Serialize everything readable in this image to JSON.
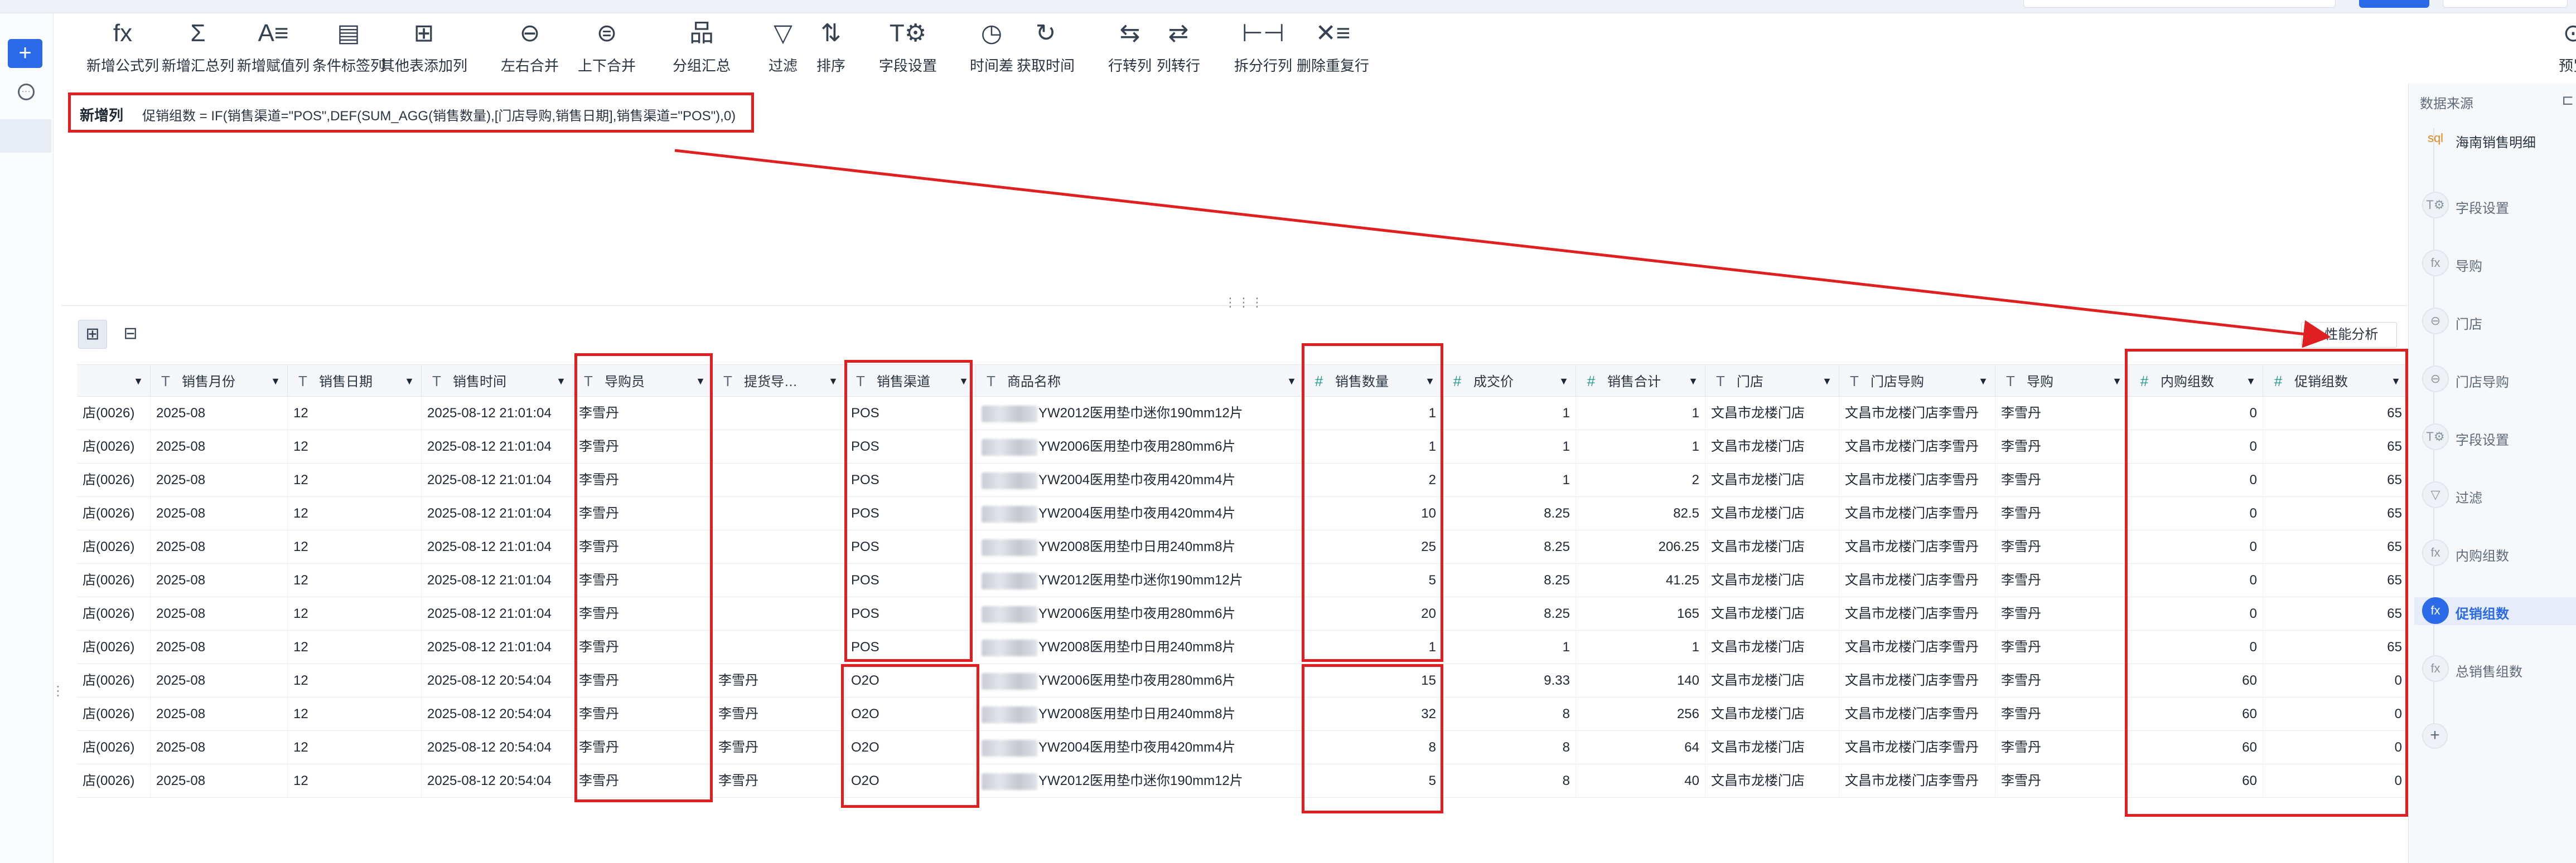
{
  "toolbar": [
    {
      "icon": "fx",
      "label": "新增公式列"
    },
    {
      "icon": "Σ",
      "label": "新增汇总列"
    },
    {
      "icon": "A≡",
      "label": "新增赋值列"
    },
    {
      "icon": "▤",
      "label": "条件标签列"
    },
    {
      "icon": "⊞",
      "label": "其他表添加列"
    },
    {
      "icon": "⊖",
      "label": "左右合并"
    },
    {
      "icon": "⊜",
      "label": "上下合并"
    },
    {
      "icon": "品",
      "label": "分组汇总"
    },
    {
      "icon": "▽",
      "label": "过滤"
    },
    {
      "icon": "⇅",
      "label": "排序"
    },
    {
      "icon": "T⚙",
      "label": "字段设置"
    },
    {
      "icon": "◷",
      "label": "时间差"
    },
    {
      "icon": "↻",
      "label": "获取时间"
    },
    {
      "icon": "⇆",
      "label": "行转列"
    },
    {
      "icon": "⇄",
      "label": "列转行"
    },
    {
      "icon": "⊢⊣",
      "label": "拆分行列"
    },
    {
      "icon": "✕≡",
      "label": "删除重复行"
    },
    {
      "icon": "⊙",
      "label": "预览"
    }
  ],
  "formula": {
    "tag": "新增列",
    "expression": "促销组数 = IF(销售渠道=\"POS\",DEF(SUM_AGG(销售数量),[门店导购,销售日期],销售渠道=\"POS\"),0)"
  },
  "perf_button": "性能分析",
  "columns": [
    {
      "name": "",
      "type": "T"
    },
    {
      "name": "销售月份",
      "type": "T"
    },
    {
      "name": "销售日期",
      "type": "T"
    },
    {
      "name": "销售时间",
      "type": "T"
    },
    {
      "name": "导购员",
      "type": "T"
    },
    {
      "name": "提货导…",
      "type": "T"
    },
    {
      "name": "销售渠道",
      "type": "T"
    },
    {
      "name": "商品名称",
      "type": "T"
    },
    {
      "name": "销售数量",
      "type": "#"
    },
    {
      "name": "成交价",
      "type": "#"
    },
    {
      "name": "销售合计",
      "type": "#"
    },
    {
      "name": "门店",
      "type": "T"
    },
    {
      "name": "门店导购",
      "type": "T"
    },
    {
      "name": "导购",
      "type": "T"
    },
    {
      "name": "内购组数",
      "type": "#"
    },
    {
      "name": "促销组数",
      "type": "#"
    }
  ],
  "rows": [
    [
      "店(0026)",
      "2025-08",
      "12",
      "2025-08-12 21:01:04",
      "李雪丹",
      "",
      "POS",
      "YW2012医用垫巾迷你190mm12片",
      "1",
      "1",
      "1",
      "文昌市龙楼门店",
      "文昌市龙楼门店李雪丹",
      "李雪丹",
      "0",
      "65"
    ],
    [
      "店(0026)",
      "2025-08",
      "12",
      "2025-08-12 21:01:04",
      "李雪丹",
      "",
      "POS",
      "YW2006医用垫巾夜用280mm6片",
      "1",
      "1",
      "1",
      "文昌市龙楼门店",
      "文昌市龙楼门店李雪丹",
      "李雪丹",
      "0",
      "65"
    ],
    [
      "店(0026)",
      "2025-08",
      "12",
      "2025-08-12 21:01:04",
      "李雪丹",
      "",
      "POS",
      "YW2004医用垫巾夜用420mm4片",
      "2",
      "1",
      "2",
      "文昌市龙楼门店",
      "文昌市龙楼门店李雪丹",
      "李雪丹",
      "0",
      "65"
    ],
    [
      "店(0026)",
      "2025-08",
      "12",
      "2025-08-12 21:01:04",
      "李雪丹",
      "",
      "POS",
      "YW2004医用垫巾夜用420mm4片",
      "10",
      "8.25",
      "82.5",
      "文昌市龙楼门店",
      "文昌市龙楼门店李雪丹",
      "李雪丹",
      "0",
      "65"
    ],
    [
      "店(0026)",
      "2025-08",
      "12",
      "2025-08-12 21:01:04",
      "李雪丹",
      "",
      "POS",
      "YW2008医用垫巾日用240mm8片",
      "25",
      "8.25",
      "206.25",
      "文昌市龙楼门店",
      "文昌市龙楼门店李雪丹",
      "李雪丹",
      "0",
      "65"
    ],
    [
      "店(0026)",
      "2025-08",
      "12",
      "2025-08-12 21:01:04",
      "李雪丹",
      "",
      "POS",
      "YW2012医用垫巾迷你190mm12片",
      "5",
      "8.25",
      "41.25",
      "文昌市龙楼门店",
      "文昌市龙楼门店李雪丹",
      "李雪丹",
      "0",
      "65"
    ],
    [
      "店(0026)",
      "2025-08",
      "12",
      "2025-08-12 21:01:04",
      "李雪丹",
      "",
      "POS",
      "YW2006医用垫巾夜用280mm6片",
      "20",
      "8.25",
      "165",
      "文昌市龙楼门店",
      "文昌市龙楼门店李雪丹",
      "李雪丹",
      "0",
      "65"
    ],
    [
      "店(0026)",
      "2025-08",
      "12",
      "2025-08-12 21:01:04",
      "李雪丹",
      "",
      "POS",
      "YW2008医用垫巾日用240mm8片",
      "1",
      "1",
      "1",
      "文昌市龙楼门店",
      "文昌市龙楼门店李雪丹",
      "李雪丹",
      "0",
      "65"
    ],
    [
      "店(0026)",
      "2025-08",
      "12",
      "2025-08-12 20:54:04",
      "李雪丹",
      "李雪丹",
      "O2O",
      "YW2006医用垫巾夜用280mm6片",
      "15",
      "9.33",
      "140",
      "文昌市龙楼门店",
      "文昌市龙楼门店李雪丹",
      "李雪丹",
      "60",
      "0"
    ],
    [
      "店(0026)",
      "2025-08",
      "12",
      "2025-08-12 20:54:04",
      "李雪丹",
      "李雪丹",
      "O2O",
      "YW2008医用垫巾日用240mm8片",
      "32",
      "8",
      "256",
      "文昌市龙楼门店",
      "文昌市龙楼门店李雪丹",
      "李雪丹",
      "60",
      "0"
    ],
    [
      "店(0026)",
      "2025-08",
      "12",
      "2025-08-12 20:54:04",
      "李雪丹",
      "李雪丹",
      "O2O",
      "YW2004医用垫巾夜用420mm4片",
      "8",
      "8",
      "64",
      "文昌市龙楼门店",
      "文昌市龙楼门店李雪丹",
      "李雪丹",
      "60",
      "0"
    ],
    [
      "店(0026)",
      "2025-08",
      "12",
      "2025-08-12 20:54:04",
      "李雪丹",
      "李雪丹",
      "O2O",
      "YW2012医用垫巾迷你190mm12片",
      "5",
      "8",
      "40",
      "文昌市龙楼门店",
      "文昌市龙楼门店李雪丹",
      "李雪丹",
      "60",
      "0"
    ]
  ],
  "right_panel": {
    "title": "数据来源",
    "steps": [
      "海南销售明细",
      "字段设置",
      "导购",
      "门店",
      "门店导购",
      "字段设置",
      "过滤",
      "内购组数",
      "促销组数",
      "总销售组数"
    ],
    "step_icons": [
      "sql",
      "T⚙",
      "fx",
      "⊖",
      "⊖",
      "T⚙",
      "▽",
      "fx",
      "fx",
      "fx"
    ],
    "selected": "促销组数"
  },
  "colors": {
    "accent": "#2a6ae8",
    "highlight": "#e02020"
  }
}
